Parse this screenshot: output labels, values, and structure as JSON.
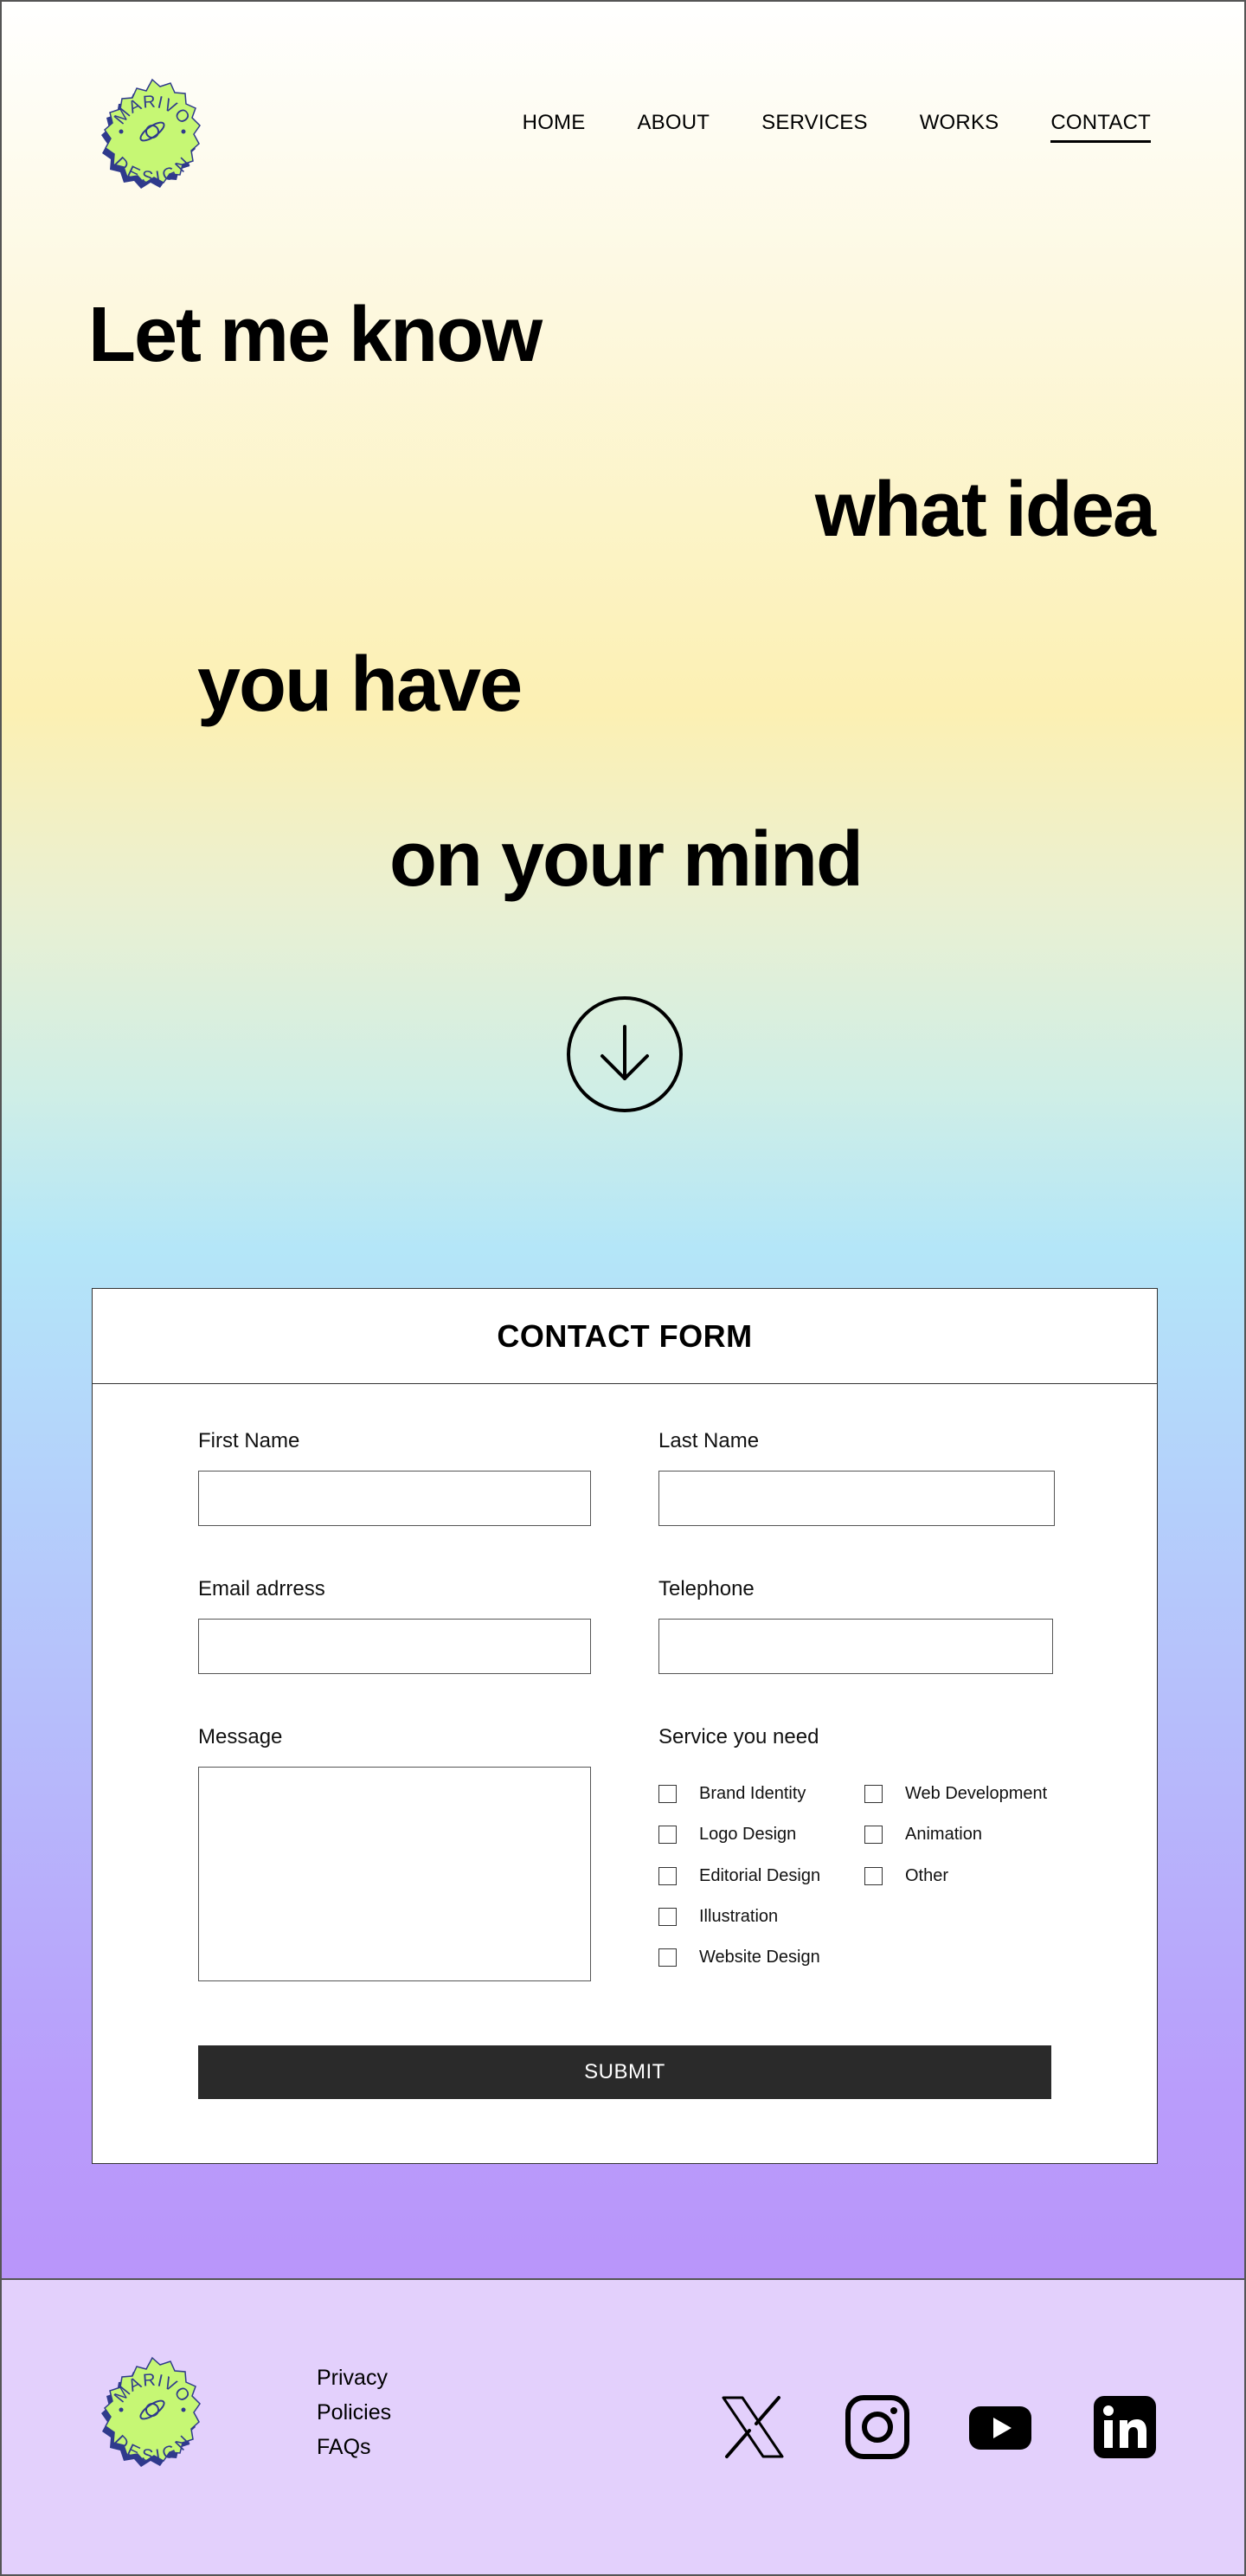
{
  "brand": {
    "logo_top": "MARIVO",
    "logo_bottom": "DESIGN",
    "logo_color": "#c6f774",
    "logo_shadow": "#2f3a8c"
  },
  "nav": {
    "items": [
      {
        "label": "HOME"
      },
      {
        "label": "ABOUT"
      },
      {
        "label": "SERVICES"
      },
      {
        "label": "WORKS"
      },
      {
        "label": "CONTACT",
        "active": true
      }
    ]
  },
  "hero": {
    "line1": "Let me know",
    "line2": "what idea",
    "line3": "you have",
    "line4": "on your mind",
    "scroll_icon": "arrow-down-circle-icon"
  },
  "contact_form": {
    "title": "CONTACT FORM",
    "first_name_label": "First Name",
    "last_name_label": "Last Name",
    "email_label": "Email adrress",
    "telephone_label": "Telephone",
    "message_label": "Message",
    "services_label": "Service you need",
    "services": [
      "Brand Identity",
      "Logo Design",
      "Editorial Design",
      "Illustration",
      "Website Design",
      "Web Development",
      "Animation",
      "Other"
    ],
    "submit_label": "SUBMIT"
  },
  "footer": {
    "links": [
      "Privacy",
      "Policies",
      "FAQs"
    ],
    "social": [
      "x-icon",
      "instagram-icon",
      "youtube-icon",
      "linkedin-icon"
    ]
  }
}
